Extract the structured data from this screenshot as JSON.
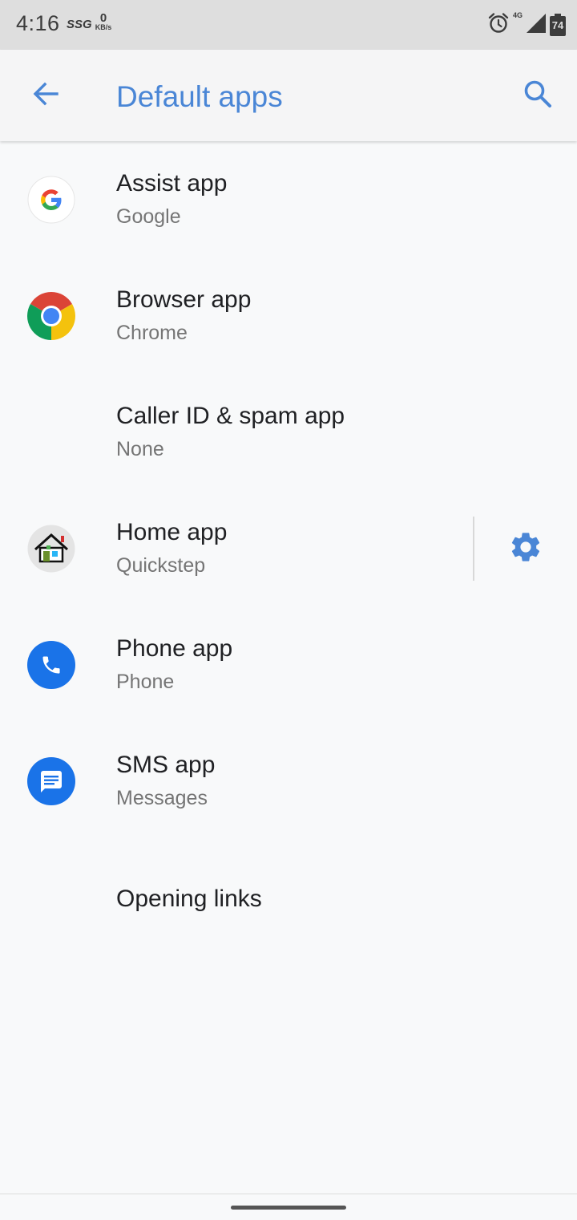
{
  "status_bar": {
    "time": "4:16",
    "carrier": "SSG",
    "speed_value": "0",
    "speed_unit": "KB/s",
    "network": "4G",
    "battery": "74",
    "icons": [
      "alarm-icon",
      "signal-icon",
      "battery-icon"
    ]
  },
  "app_bar": {
    "title": "Default apps",
    "back_icon": "arrow-back-icon",
    "search_icon": "search-icon",
    "accent_color": "#4a86d6"
  },
  "items": [
    {
      "title": "Assist app",
      "subtitle": "Google",
      "icon": "google-icon"
    },
    {
      "title": "Browser app",
      "subtitle": "Chrome",
      "icon": "chrome-icon"
    },
    {
      "title": "Caller ID & spam app",
      "subtitle": "None",
      "icon": ""
    },
    {
      "title": "Home app",
      "subtitle": "Quickstep",
      "icon": "home-launcher-icon",
      "action_icon": "gear-icon"
    },
    {
      "title": "Phone app",
      "subtitle": "Phone",
      "icon": "phone-icon"
    },
    {
      "title": "SMS app",
      "subtitle": "Messages",
      "icon": "messages-icon"
    },
    {
      "title": "Opening links",
      "subtitle": "",
      "icon": ""
    }
  ]
}
